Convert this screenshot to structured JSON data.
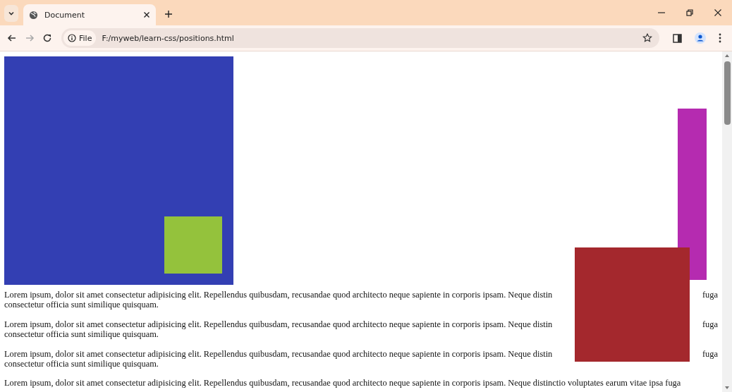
{
  "tab": {
    "title": "Document",
    "selected": true
  },
  "address_bar": {
    "scheme_label": "File",
    "url": "F:/myweb/learn-css/positions.html"
  },
  "paragraphs": [
    {
      "line_1_start": "Lorem ipsum, dolor sit amet consectetur adipisicing elit. Repellendus quibusdam, recusandae quod architecto neque sapiente in corporis ipsam. Neque distin",
      "line_1_end": "fuga",
      "line_2": "consectetur officia sunt similique quisquam."
    },
    {
      "line_1_start": "Lorem ipsum, dolor sit amet consectetur adipisicing elit. Repellendus quibusdam, recusandae quod architecto neque sapiente in corporis ipsam. Neque distin",
      "line_1_end": "fuga",
      "line_2": "consectetur officia sunt similique quisquam."
    },
    {
      "line_1_start": "Lorem ipsum, dolor sit amet consectetur adipisicing elit. Repellendus quibusdam, recusandae quod architecto neque sapiente in corporis ipsam. Neque distin",
      "line_1_end": "fuga",
      "line_2": "consectetur officia sunt similique quisquam."
    },
    {
      "line_1_start": "Lorem ipsum, dolor sit amet consectetur adipisicing elit. Repellendus quibusdam, recusandae quod architecto neque sapiente in corporis ipsam. Neque distinctio voluptates earum vitae ipsa fuga"
    }
  ]
}
